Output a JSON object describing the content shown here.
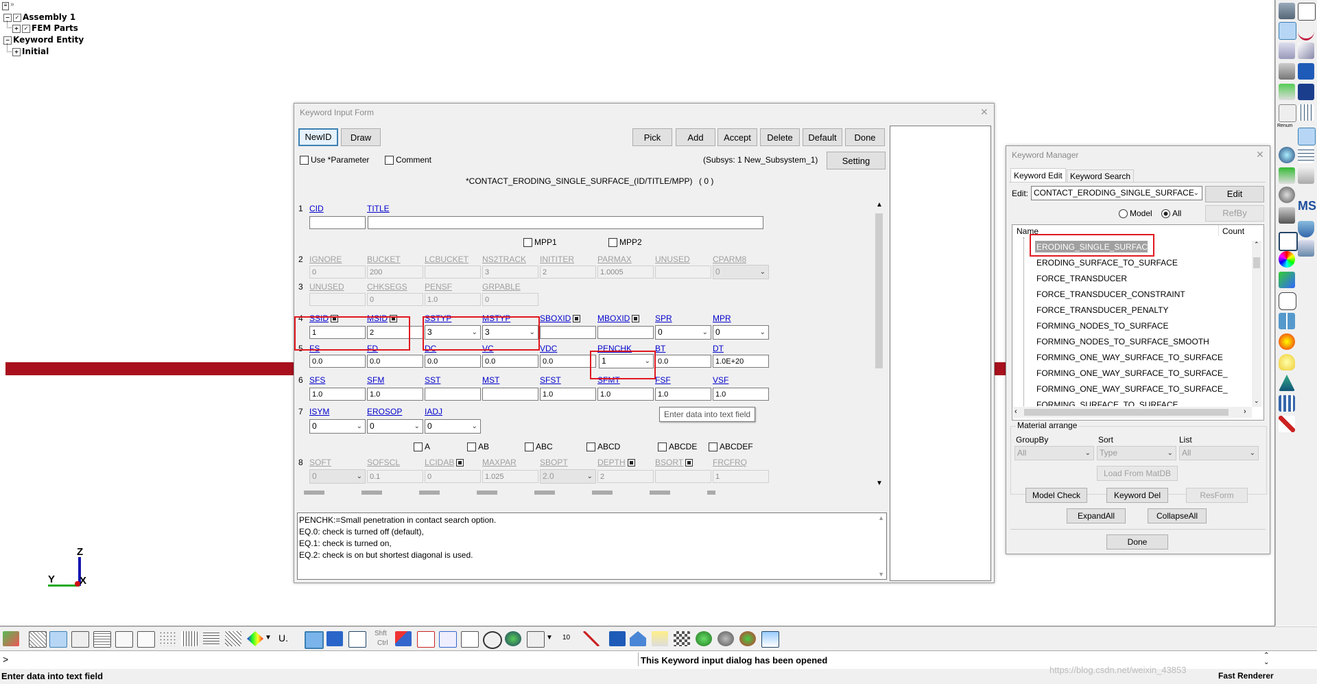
{
  "tree": {
    "items": [
      "Assembly 1",
      "FEM Parts",
      "Keyword Entity",
      "Initial"
    ]
  },
  "axes": {
    "z": "Z",
    "y": "Y",
    "x": "X"
  },
  "kif": {
    "title": "Keyword Input Form",
    "buttons_left": [
      "NewID",
      "Draw"
    ],
    "buttons_right": [
      "Pick",
      "Add",
      "Accept",
      "Delete",
      "Default",
      "Done"
    ],
    "use_parameter": "Use *Parameter",
    "comment": "Comment",
    "subsys": "(Subsys: 1 New_Subsystem_1)",
    "setting": "Setting",
    "keyword": "*CONTACT_ERODING_SINGLE_SURFACE_(ID/TITLE/MPP)",
    "count": "( 0 )",
    "row1": {
      "num": "1",
      "cid": "CID",
      "title": "TITLE"
    },
    "mpp1": "MPP1",
    "mpp2": "MPP2",
    "row2": {
      "num": "2",
      "labels": [
        "IGNORE",
        "BUCKET",
        "LCBUCKET",
        "NS2TRACK",
        "INITITER",
        "PARMAX",
        "UNUSED",
        "CPARM8"
      ],
      "values": [
        "0",
        "200",
        "",
        "3",
        "2",
        "1.0005",
        "",
        "0"
      ]
    },
    "row3": {
      "num": "3",
      "labels": [
        "UNUSED",
        "CHKSEGS",
        "PENSF",
        "GRPABLE"
      ],
      "values": [
        "",
        "0",
        "1.0",
        "0"
      ]
    },
    "row4": {
      "num": "4",
      "labels": [
        "SSID",
        "MSID",
        "SSTYP",
        "MSTYP",
        "SBOXID",
        "MBOXID",
        "SPR",
        "MPR"
      ],
      "values": [
        "1",
        "2",
        "3",
        "3",
        "",
        "",
        "0",
        "0"
      ]
    },
    "row5": {
      "num": "5",
      "labels": [
        "FS",
        "FD",
        "DC",
        "VC",
        "VDC",
        "PENCHK",
        "BT",
        "DT"
      ],
      "values": [
        "0.0",
        "0.0",
        "0.0",
        "0.0",
        "0.0",
        "1",
        "0.0",
        "1.0E+20"
      ]
    },
    "row6": {
      "num": "6",
      "labels": [
        "SFS",
        "SFM",
        "SST",
        "MST",
        "SFST",
        "SFMT",
        "FSF",
        "VSF"
      ],
      "values": [
        "1.0",
        "1.0",
        "",
        "",
        "1.0",
        "1.0",
        "1.0",
        "1.0"
      ]
    },
    "row7": {
      "num": "7",
      "labels": [
        "ISYM",
        "EROSOP",
        "IADJ"
      ],
      "values": [
        "0",
        "0",
        "0"
      ]
    },
    "tooltip": "Enter data into text field",
    "abc": [
      "A",
      "AB",
      "ABC",
      "ABCD",
      "ABCDE",
      "ABCDEF"
    ],
    "row8": {
      "num": "8",
      "labels": [
        "SOFT",
        "SOFSCL",
        "LCIDAB",
        "MAXPAR",
        "SBOPT",
        "DEPTH",
        "BSORT",
        "FRCFRQ"
      ],
      "values": [
        "0",
        "0.1",
        "0",
        "1.025",
        "2.0",
        "2",
        "",
        "1"
      ]
    },
    "help": [
      "PENCHK:=Small penetration in contact search option.",
      "EQ.0: check is turned off (default),",
      "EQ.1: check is turned on,",
      "EQ.2: check is on but shortest diagonal is used."
    ]
  },
  "km": {
    "title": "Keyword Manager",
    "tabs": [
      "Keyword Edit",
      "Keyword Search"
    ],
    "edit_label": "Edit:",
    "edit_value": "CONTACT_ERODING_SINGLE_SURFACE",
    "edit_btn": "Edit",
    "model": "Model",
    "all": "All",
    "refby": "RefBy",
    "col_name": "Name",
    "col_count": "Count",
    "items": [
      "ERODING_SINGLE_SURFACE",
      "ERODING_SURFACE_TO_SURFACE",
      "FORCE_TRANSDUCER",
      "FORCE_TRANSDUCER_CONSTRAINT",
      "FORCE_TRANSDUCER_PENALTY",
      "FORMING_NODES_TO_SURFACE",
      "FORMING_NODES_TO_SURFACE_SMOOTH",
      "FORMING_ONE_WAY_SURFACE_TO_SURFACE",
      "FORMING_ONE_WAY_SURFACE_TO_SURFACE_",
      "FORMING_ONE_WAY_SURFACE_TO_SURFACE_",
      "FORMING_SURFACE_TO_SURFACE"
    ],
    "material_arrange": "Material arrange",
    "groupby": "GroupBy",
    "sort": "Sort",
    "list": "List",
    "groupby_val": "All",
    "sort_val": "Type",
    "list_val": "All",
    "load_matdb": "Load From MatDB",
    "model_check": "Model Check",
    "keyword_del": "Keyword Del",
    "resform": "ResForm",
    "expand_all": "ExpandAll",
    "collapse_all": "CollapseAll",
    "done": "Done"
  },
  "bottom": {
    "shft": "Shft",
    "ctrl": "Ctrl",
    "u_label": "U.",
    "ten": "10",
    "prompt": ">",
    "message": "This Keyword input dialog has been opened",
    "status_left": "Enter data into text field",
    "status_right": "Fast Renderer",
    "watermark": "https://blog.csdn.net/weixin_43853"
  },
  "rtool": {
    "ms": "MS",
    "renum": "Renum"
  }
}
